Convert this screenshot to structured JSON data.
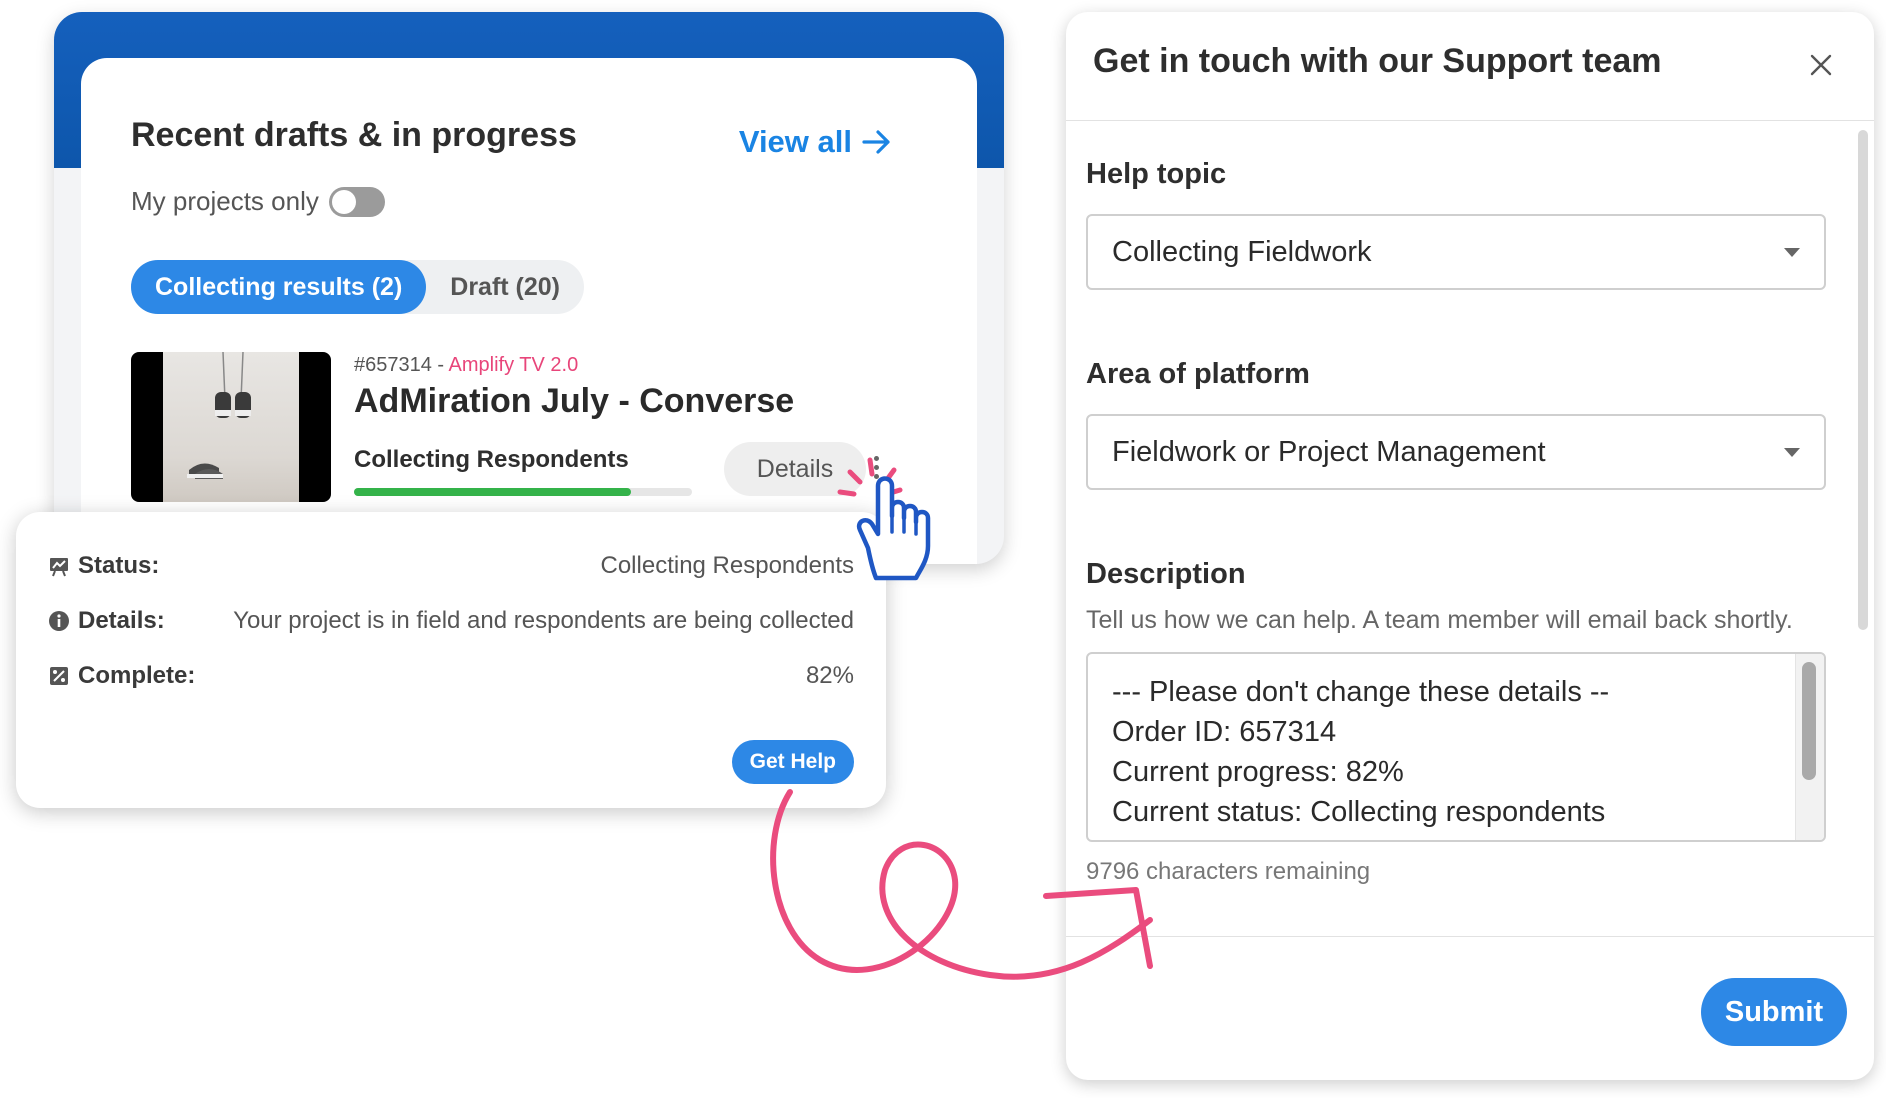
{
  "left_card": {
    "title": "Recent drafts & in progress",
    "view_all": "View all",
    "toggle_label": "My projects only",
    "toggle_on": false,
    "tabs": [
      {
        "label": "Collecting results (2)",
        "active": true
      },
      {
        "label": "Draft (20)",
        "active": false
      }
    ],
    "project": {
      "id": "#657314",
      "separator": " - ",
      "brand": "Amplify TV 2.0",
      "title": "AdMiration July - Converse",
      "status": "Collecting Respondents",
      "progress": 0.82,
      "details_label": "Details"
    }
  },
  "popover": {
    "rows": [
      {
        "icon": "chart-board-icon",
        "label": "Status:",
        "value": "Collecting Respondents"
      },
      {
        "icon": "info-icon",
        "label": "Details:",
        "value": "Your project is in field and respondents are being collected"
      },
      {
        "icon": "percent-icon",
        "label": "Complete:",
        "value": "82%"
      }
    ],
    "get_help": "Get Help"
  },
  "modal": {
    "title": "Get in touch with our Support team",
    "help_topic_label": "Help topic",
    "help_topic_value": "Collecting Fieldwork",
    "area_label": "Area of platform",
    "area_value": "Fieldwork or Project Management",
    "description_label": "Description",
    "description_hint": "Tell us how we can help. A team member will email back shortly.",
    "description_lines": [
      "--- Please don't change these details --",
      "Order ID: 657314",
      "Current progress: 82%",
      "Current status: Collecting respondents"
    ],
    "remaining": "9796 characters remaining",
    "submit": "Submit"
  },
  "colors": {
    "primary": "#2d88e6",
    "header_band": "#1560bd",
    "brand_pink": "#e8457a",
    "progress_green": "#34b34a",
    "cursor_blue": "#1f57c4"
  }
}
